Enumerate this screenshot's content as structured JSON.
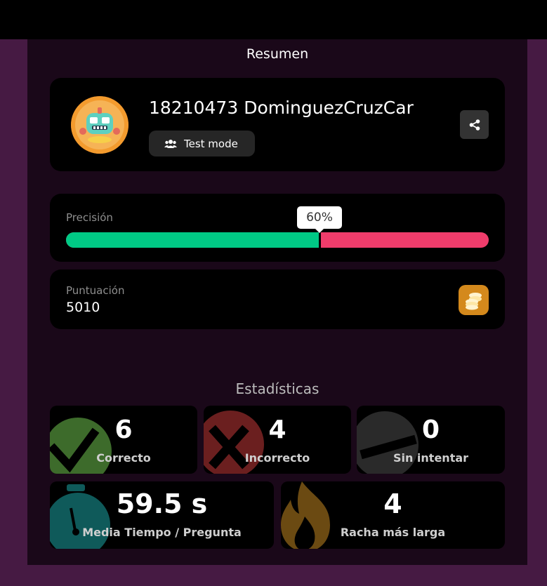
{
  "summary": {
    "title": "Resumen",
    "player_name": "18210473 DominguezCruzCar",
    "mode_label": "Test mode",
    "share_icon": "share-icon"
  },
  "accuracy": {
    "label": "Precisión",
    "percent_text": "60%",
    "percent_value": 60,
    "correct_color": "#00c985",
    "incorrect_color": "#ef3c6b"
  },
  "score": {
    "label": "Puntuación",
    "value": "5010",
    "icon": "coins-icon"
  },
  "stats": {
    "title": "Estadísticas",
    "correct": {
      "value": "6",
      "label": "Correcto",
      "icon": "check-icon",
      "color": "#3d6b2b"
    },
    "incorrect": {
      "value": "4",
      "label": "Incorrecto",
      "icon": "cross-icon",
      "color": "#6b1f1f"
    },
    "unattempted": {
      "value": "0",
      "label": "Sin intentar",
      "icon": "minus-icon",
      "color": "#2a2a2a"
    },
    "avg_time": {
      "value": "59.5 s",
      "label": "Media Tiempo / Pregunta",
      "icon": "stopwatch-icon",
      "color": "#0f5a5a"
    },
    "streak": {
      "value": "4",
      "label": "Racha más larga",
      "icon": "fire-icon",
      "color": "#6b4a12"
    }
  },
  "colors": {
    "page_background": "#461a43",
    "panel_background": "#1a0819",
    "card_background": "#000000"
  }
}
